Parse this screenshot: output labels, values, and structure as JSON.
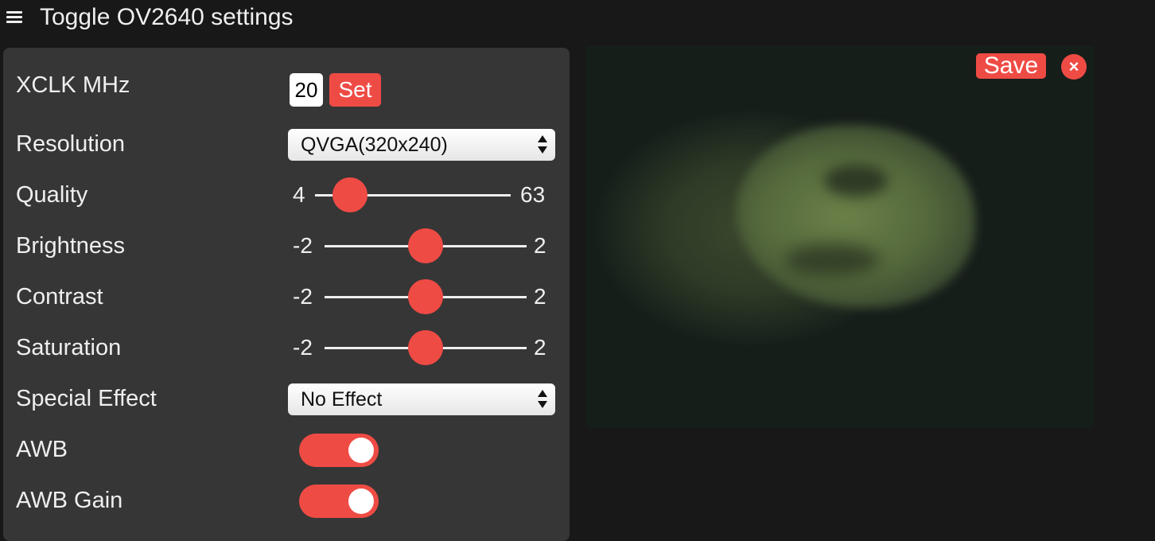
{
  "header": {
    "toggle_label": "Toggle OV2640 settings"
  },
  "settings": {
    "xclk": {
      "label": "XCLK MHz",
      "value": "20",
      "button": "Set"
    },
    "resolution": {
      "label": "Resolution",
      "selected": "QVGA(320x240)"
    },
    "quality": {
      "label": "Quality",
      "min": "4",
      "max": "63",
      "value": 10
    },
    "brightness": {
      "label": "Brightness",
      "min": "-2",
      "max": "2",
      "value": 0
    },
    "contrast": {
      "label": "Contrast",
      "min": "-2",
      "max": "2",
      "value": 0
    },
    "saturation": {
      "label": "Saturation",
      "min": "-2",
      "max": "2",
      "value": 0
    },
    "special_effect": {
      "label": "Special Effect",
      "selected": "No Effect"
    },
    "awb": {
      "label": "AWB",
      "on": true
    },
    "awb_gain": {
      "label": "AWB Gain",
      "on": true
    }
  },
  "stream": {
    "save_label": "Save",
    "close_label": "×"
  },
  "colors": {
    "accent": "#ef4b45",
    "panel": "#363636",
    "background": "#181818"
  }
}
